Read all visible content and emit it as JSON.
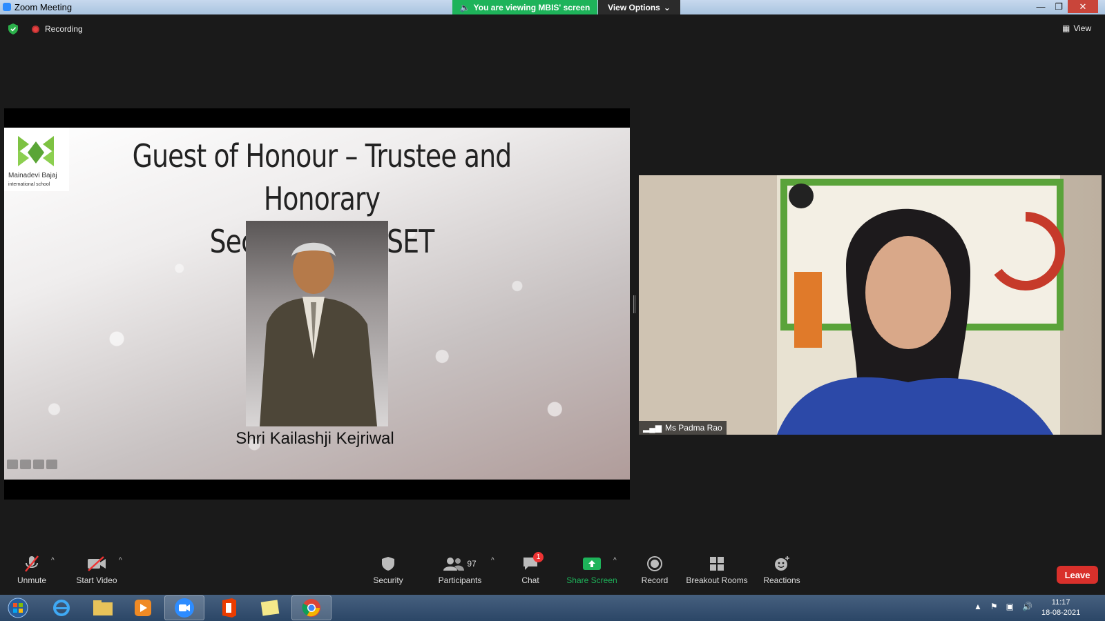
{
  "window": {
    "title": "Zoom Meeting",
    "viewing_banner": "You are viewing MBIS' screen",
    "view_options": "View Options"
  },
  "status": {
    "recording": "Recording",
    "view": "View"
  },
  "slide": {
    "school_name": "Mainadevi Bajaj",
    "school_sub": "international school",
    "title_line1": "Guest of Honour – Trustee and Honorary",
    "title_line2": "Secretary of RSET",
    "caption": "Shri Kailashji Kejriwal"
  },
  "video": {
    "participant_name": "Ms Padma Rao"
  },
  "toolbar": {
    "unmute": "Unmute",
    "start_video": "Start Video",
    "security": "Security",
    "participants": "Participants",
    "participants_count": "97",
    "chat": "Chat",
    "chat_badge": "1",
    "share_screen": "Share Screen",
    "record": "Record",
    "breakout_rooms": "Breakout Rooms",
    "reactions": "Reactions",
    "leave": "Leave"
  },
  "taskbar": {
    "time": "11:17",
    "date": "18-08-2021"
  },
  "colors": {
    "share_green": "#1eb35a",
    "leave_red": "#d9302b",
    "background": "#1a1a1a"
  }
}
